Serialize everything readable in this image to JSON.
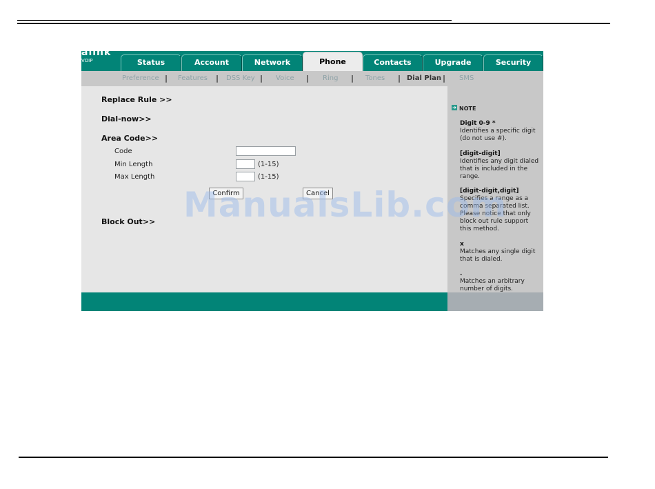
{
  "logo": {
    "line1": "alink",
    "line2": "VOIP"
  },
  "tabs": [
    {
      "label": "Status",
      "active": false
    },
    {
      "label": "Account",
      "active": false
    },
    {
      "label": "Network",
      "active": false
    },
    {
      "label": "Phone",
      "active": true
    },
    {
      "label": "Contacts",
      "active": false
    },
    {
      "label": "Upgrade",
      "active": false
    },
    {
      "label": "Security",
      "active": false
    }
  ],
  "subnav": [
    {
      "label": "Preference"
    },
    {
      "label": "Features"
    },
    {
      "label": "DSS Key"
    },
    {
      "label": "Voice"
    },
    {
      "label": "Ring"
    },
    {
      "label": "Tones"
    },
    {
      "label": "Dial Plan",
      "active": true
    },
    {
      "label": "SMS"
    }
  ],
  "subnav_separator": "|",
  "sections": {
    "replace_rule": "Replace Rule >>",
    "dial_now": "Dial-now>>",
    "area_code": "Area Code>>",
    "block_out": "Block Out>>"
  },
  "area_code_form": {
    "code_label": "Code",
    "code_value": "",
    "min_length_label": "Min Length",
    "min_length_value": "",
    "min_length_hint": "(1-15)",
    "max_length_label": "Max Length",
    "max_length_value": "",
    "max_length_hint": "(1-15)",
    "confirm_label": "Confirm",
    "cancel_label": "Cancel"
  },
  "note": {
    "title": "NOTE",
    "items": [
      {
        "title": "Digit 0-9 *",
        "text": "Identifies a specific digit (do not use #)."
      },
      {
        "title": "[digit-digit]",
        "text": "Identifies any digit dialed that is included in the range."
      },
      {
        "title": "[digit-digit,digit]",
        "text": "Specifies a range as a comma separated list. Please notice that only block out rule support this method."
      },
      {
        "title": "x",
        "text": "Matches any single digit that is dialed."
      },
      {
        "title": ".",
        "text": "Matches an arbitrary number of digits."
      }
    ]
  },
  "watermark": "ManualsLib.com",
  "colors": {
    "header": "#028477",
    "subnav": "#c8c8c8",
    "main": "#e6e6e6",
    "note_panel": "#c8c8c8"
  }
}
